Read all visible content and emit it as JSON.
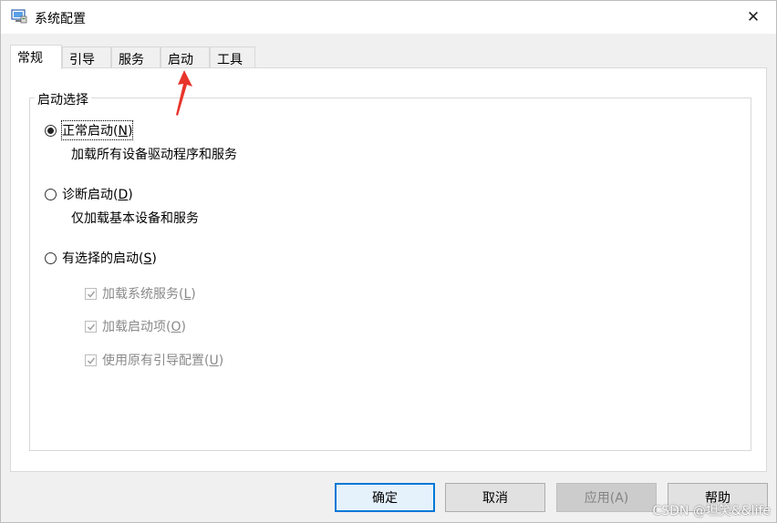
{
  "window": {
    "title": "系统配置",
    "close_glyph": "✕"
  },
  "tabs": [
    {
      "label": "常规",
      "active": true
    },
    {
      "label": "引导",
      "active": false
    },
    {
      "label": "服务",
      "active": false
    },
    {
      "label": "启动",
      "active": false
    },
    {
      "label": "工具",
      "active": false
    }
  ],
  "group": {
    "title": "启动选择"
  },
  "options": {
    "normal": {
      "label": "正常启动(",
      "key": "N",
      "suffix": ")",
      "desc": "加载所有设备驱动程序和服务",
      "checked": true
    },
    "diagnostic": {
      "label": "诊断启动(",
      "key": "D",
      "suffix": ")",
      "desc": "仅加载基本设备和服务",
      "checked": false
    },
    "selective": {
      "label": "有选择的启动(",
      "key": "S",
      "suffix": ")",
      "checked": false
    }
  },
  "checks": [
    {
      "label": "加载系统服务(",
      "key": "L",
      "suffix": ")",
      "checked": true
    },
    {
      "label": "加载启动项(",
      "key": "O",
      "suffix": ")",
      "checked": true
    },
    {
      "label": "使用原有引导配置(",
      "key": "U",
      "suffix": ")",
      "checked": true
    }
  ],
  "buttons": {
    "ok": "确定",
    "cancel": "取消",
    "apply": "应用(A)",
    "help": "帮助"
  },
  "watermark": "CSDN @坦笑&&life",
  "colors": {
    "accent": "#0078d7",
    "arrow": "#e8352b",
    "disabled_text": "#8a8a8a"
  },
  "icons": {
    "app": "system-config-icon",
    "close": "close-icon",
    "annotation": "red-arrow-icon"
  }
}
